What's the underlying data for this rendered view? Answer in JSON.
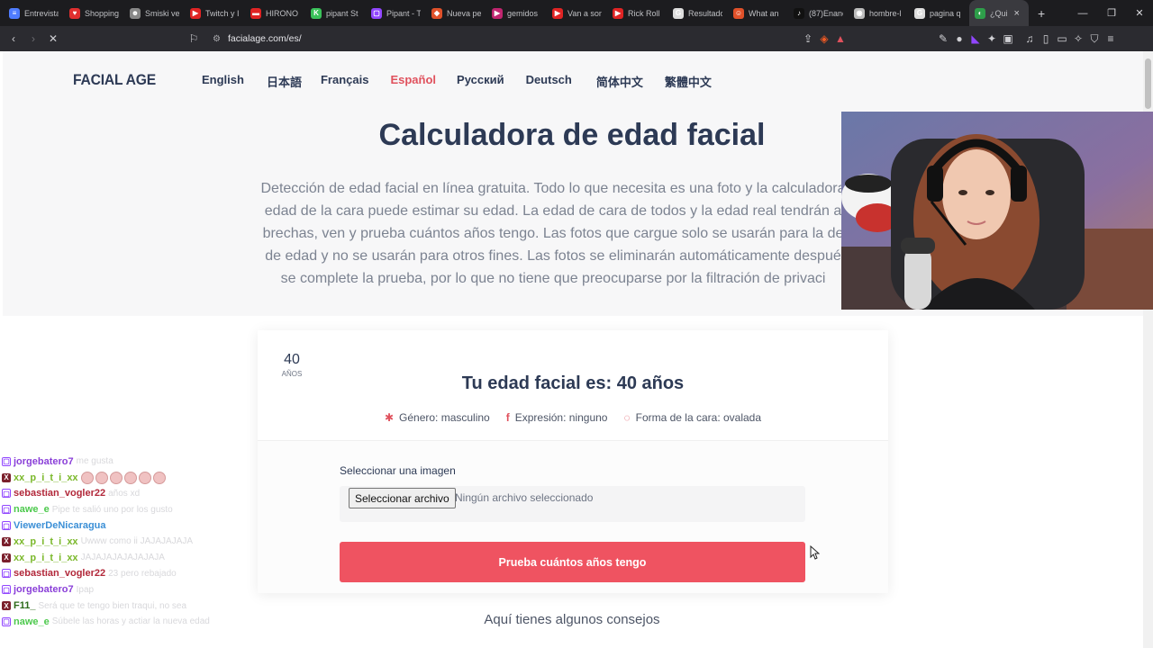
{
  "browser": {
    "tabs": [
      {
        "title": "Entrevista",
        "fav_color": "#4f7cff",
        "fav_glyph": "≡"
      },
      {
        "title": "Shopping",
        "fav_color": "#e02f2f",
        "fav_glyph": "♥"
      },
      {
        "title": "Smiski ve",
        "fav_color": "#888",
        "fav_glyph": "☻"
      },
      {
        "title": "Twitch y I",
        "fav_color": "#e02424",
        "fav_glyph": "▶"
      },
      {
        "title": "HIRONO",
        "fav_color": "#e02424",
        "fav_glyph": "▬"
      },
      {
        "title": "pipant St",
        "fav_color": "#3ac25a",
        "fav_glyph": "K"
      },
      {
        "title": "Pipant - T",
        "fav_color": "#9146ff",
        "fav_glyph": "▢"
      },
      {
        "title": "Nueva pe",
        "fav_color": "#e0512a",
        "fav_glyph": "◆"
      },
      {
        "title": "gemidos",
        "fav_color": "#c0256f",
        "fav_glyph": "▶"
      },
      {
        "title": "Van a son",
        "fav_color": "#e02424",
        "fav_glyph": "▶"
      },
      {
        "title": "Rick Roll",
        "fav_color": "#e02424",
        "fav_glyph": "▶"
      },
      {
        "title": "Resultado",
        "fav_color": "#dddddd",
        "fav_glyph": "G"
      },
      {
        "title": "What an",
        "fav_color": "#e0512a",
        "fav_glyph": "☺"
      },
      {
        "title": "(87)Enanc",
        "fav_color": "#111",
        "fav_glyph": "♪"
      },
      {
        "title": "hombre-l",
        "fav_color": "#bbb",
        "fav_glyph": "◉"
      },
      {
        "title": "pagina q",
        "fav_color": "#dddddd",
        "fav_glyph": "G"
      },
      {
        "title": "¿Qui",
        "fav_color": "#2e9e4a",
        "fav_glyph": "◐",
        "active": true
      }
    ],
    "url": "facialage.com/es/",
    "new_tab_glyph": "+",
    "close_glyph": "×"
  },
  "site": {
    "logo": "FACIAL AGE",
    "languages": [
      {
        "label": "English",
        "active": false
      },
      {
        "label": "日本語",
        "active": false
      },
      {
        "label": "Français",
        "active": false
      },
      {
        "label": "Español",
        "active": true
      },
      {
        "label": "Русский",
        "active": false
      },
      {
        "label": "Deutsch",
        "active": false
      },
      {
        "label": "简体中文",
        "active": false
      },
      {
        "label": "繁體中文",
        "active": false
      }
    ],
    "hero_title": "Calculadora de edad facial",
    "hero_desc_lines": [
      "Detección de edad facial en línea gratuita. Todo lo que necesita es una foto y la calculadora",
      "edad de la cara puede estimar su edad. La edad de cara de todos y la edad real tendrán a",
      "brechas, ven y prueba cuántos años tengo. Las fotos que cargue solo se usarán para la de",
      "de edad y no se usarán para otros fines. Las fotos se eliminarán automáticamente despué",
      "se complete la prueba, por lo que no tiene que preocuparse por la filtración de privaci"
    ],
    "result": {
      "age_number": "40",
      "age_unit": "AÑOS",
      "title": "Tu edad facial es: 40 años",
      "gender": "Género: masculino",
      "expression": "Expresión: ninguno",
      "face_shape": "Forma de la cara: ovalada"
    },
    "upload": {
      "label": "Seleccionar una imagen",
      "file_button": "Seleccionar archivo",
      "no_file": "Ningún archivo seleccionado",
      "submit": "Prueba cuántos años tengo"
    },
    "tips_title": "Aquí tienes algunos consejos"
  },
  "chat": [
    {
      "user": "jorgebatero7",
      "color": "#8a3fd8",
      "badge": "tw",
      "msg": "me gusta"
    },
    {
      "user": "xx_p_i_t_i_xx",
      "color": "#7ab82a",
      "badge": "x",
      "msg": "",
      "emotes": 6
    },
    {
      "user": "sebastian_vogler22",
      "color": "#b2283a",
      "badge": "tw",
      "msg": "años xd"
    },
    {
      "user": "nawe_e",
      "color": "#4cc94c",
      "badge": "tw",
      "msg": "Pipe te salió uno por los gusto"
    },
    {
      "user": "ViewerDeNicaragua",
      "color": "#3b8fd6",
      "badge": "tw",
      "msg": ""
    },
    {
      "user": "xx_p_i_t_i_xx",
      "color": "#7ab82a",
      "badge": "x",
      "msg": "Uwww como ii JAJAJAJAJA"
    },
    {
      "user": "xx_p_i_t_i_xx",
      "color": "#7ab82a",
      "badge": "x",
      "msg": "JAJAJAJAJAJAJAJA"
    },
    {
      "user": "sebastian_vogler22",
      "color": "#b2283a",
      "badge": "tw",
      "msg": "23 pero rebajado"
    },
    {
      "user": "jorgebatero7",
      "color": "#8a3fd8",
      "badge": "tw",
      "msg": "Ipap"
    },
    {
      "user": "F11_",
      "color": "#2d6b1a",
      "badge": "x",
      "msg": "Será que te tengo bien traqui, no sea"
    },
    {
      "user": "nawe_e",
      "color": "#4cc94c",
      "badge": "tw",
      "msg": "Súbele las horas y actiar la nueva edad"
    }
  ]
}
